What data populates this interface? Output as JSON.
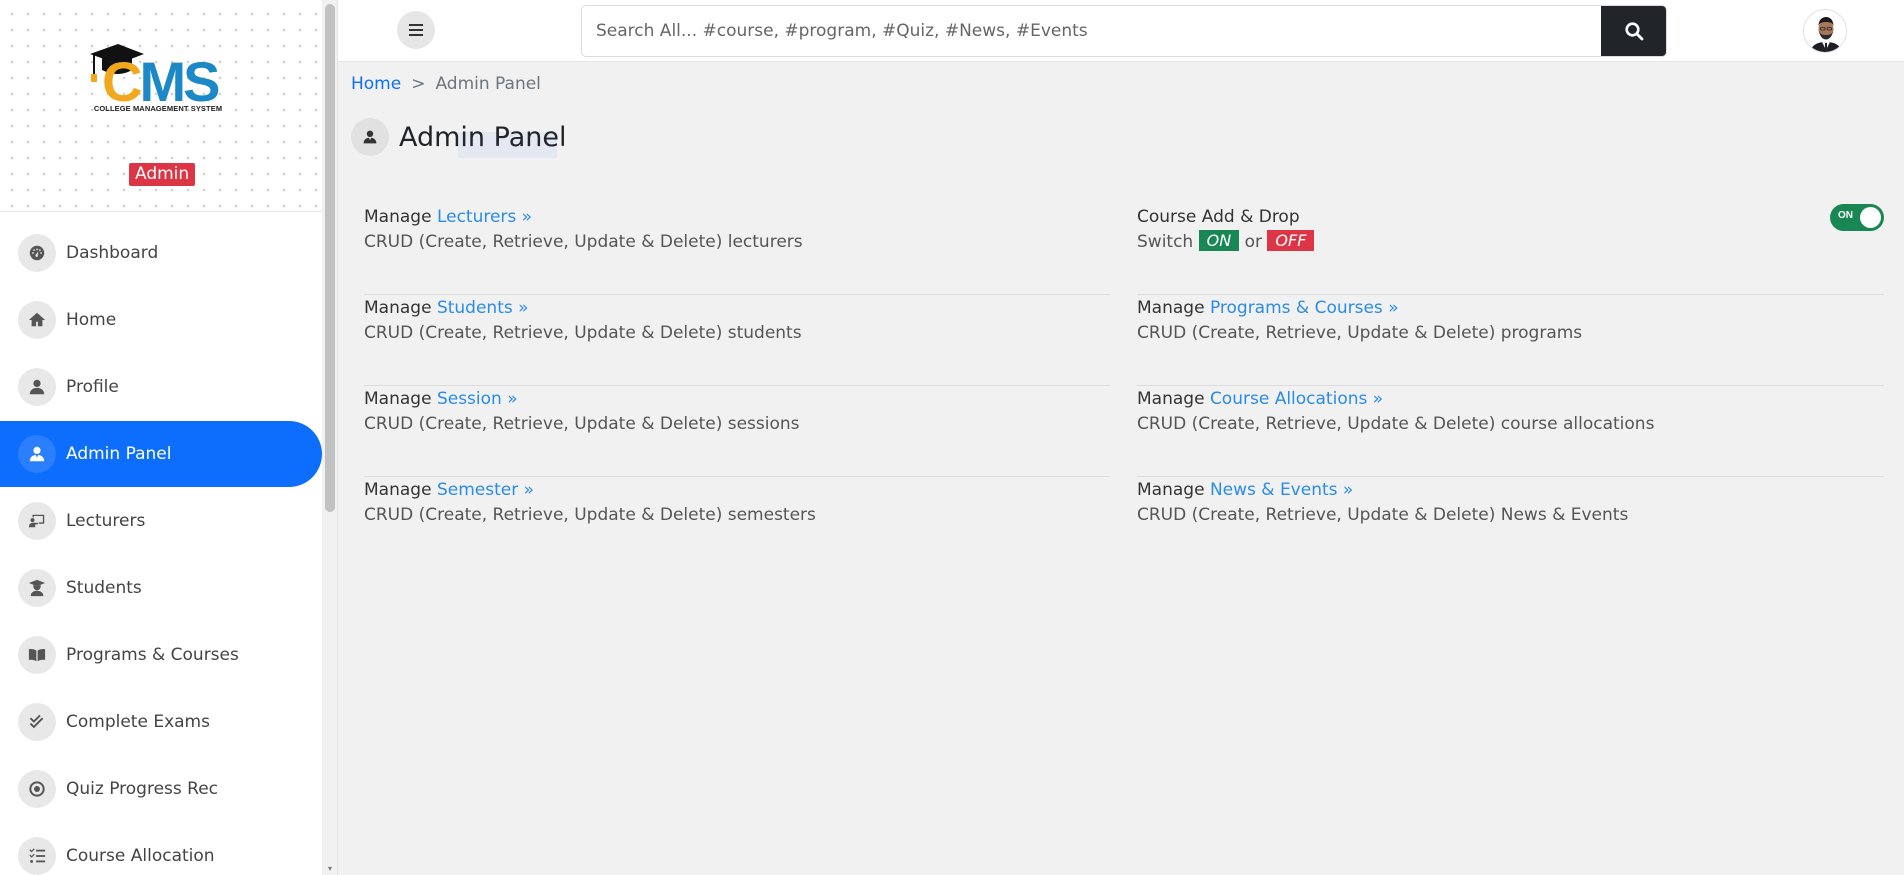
{
  "brand": {
    "logo_c": "C",
    "logo_ms": "MS",
    "logo_subtitle": "COLLEGE MANAGEMENT SYSTEM",
    "role": "Admin"
  },
  "sidebar": {
    "items": [
      {
        "label": "Dashboard",
        "icon": "dashboard-icon"
      },
      {
        "label": "Home",
        "icon": "home-icon"
      },
      {
        "label": "Profile",
        "icon": "user-icon"
      },
      {
        "label": "Admin Panel",
        "icon": "user-tie-icon",
        "active": true
      },
      {
        "label": "Lecturers",
        "icon": "chalkboard-teacher-icon"
      },
      {
        "label": "Students",
        "icon": "user-graduate-icon"
      },
      {
        "label": "Programs & Courses",
        "icon": "book-open-icon"
      },
      {
        "label": "Complete Exams",
        "icon": "check-double-icon"
      },
      {
        "label": "Quiz Progress Rec",
        "icon": "record-icon"
      },
      {
        "label": "Course Allocation",
        "icon": "tasks-icon"
      }
    ]
  },
  "topbar": {
    "search_placeholder": "Search All... #course, #program, #Quiz, #News, #Events"
  },
  "breadcrumb": {
    "home": "Home",
    "separator": ">",
    "current": "Admin Panel"
  },
  "page": {
    "title": "Admin Panel"
  },
  "panel": {
    "left": [
      {
        "prefix": "Manage",
        "link": "Lecturers »",
        "desc": "CRUD (Create, Retrieve, Update & Delete) lecturers"
      },
      {
        "prefix": "Manage",
        "link": "Students »",
        "desc": "CRUD (Create, Retrieve, Update & Delete) students"
      },
      {
        "prefix": "Manage",
        "link": "Session »",
        "desc": "CRUD (Create, Retrieve, Update & Delete) sessions"
      },
      {
        "prefix": "Manage",
        "link": "Semester »",
        "desc": "CRUD (Create, Retrieve, Update & Delete) semesters"
      }
    ],
    "course_add_drop": {
      "title": "Course Add & Drop",
      "switch_word": "Switch",
      "on": "ON",
      "or": "or",
      "off": "OFF",
      "toggle_label": "ON",
      "toggle_state": true
    },
    "right": [
      {
        "prefix": "Manage",
        "link": "Programs & Courses »",
        "desc": "CRUD (Create, Retrieve, Update & Delete) programs"
      },
      {
        "prefix": "Manage",
        "link": "Course Allocations »",
        "desc": "CRUD (Create, Retrieve, Update & Delete) course allocations"
      },
      {
        "prefix": "Manage",
        "link": "News & Events »",
        "desc": "CRUD (Create, Retrieve, Update & Delete) News & Events"
      }
    ]
  },
  "colors": {
    "primary": "#0d6efd",
    "link": "#2b8be8",
    "success": "#198754",
    "danger": "#dc3545",
    "dark": "#212529"
  }
}
